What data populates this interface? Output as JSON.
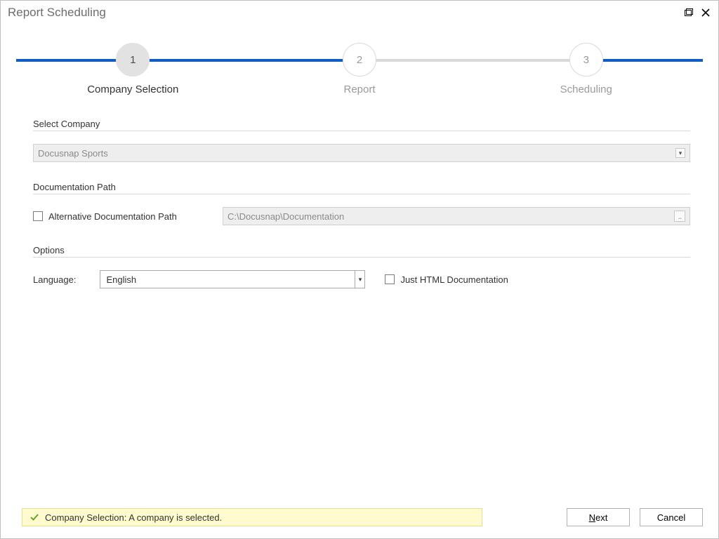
{
  "window": {
    "title": "Report Scheduling"
  },
  "steps": [
    {
      "num": "1",
      "label": "Company Selection",
      "active": true
    },
    {
      "num": "2",
      "label": "Report",
      "active": false
    },
    {
      "num": "3",
      "label": "Scheduling",
      "active": false
    }
  ],
  "sections": {
    "company": {
      "heading": "Select Company",
      "selected": "Docusnap Sports"
    },
    "docpath": {
      "heading": "Documentation Path",
      "checkbox_label": "Alternative Documentation Path",
      "path": "C:\\Docusnap\\Documentation"
    },
    "options": {
      "heading": "Options",
      "language_label": "Language:",
      "language_value": "English",
      "html_only_label": "Just HTML Documentation"
    }
  },
  "status": {
    "text": "Company Selection: A company is selected."
  },
  "buttons": {
    "next": "Next",
    "next_ul": "N",
    "next_rest": "ext",
    "cancel": "Cancel"
  }
}
